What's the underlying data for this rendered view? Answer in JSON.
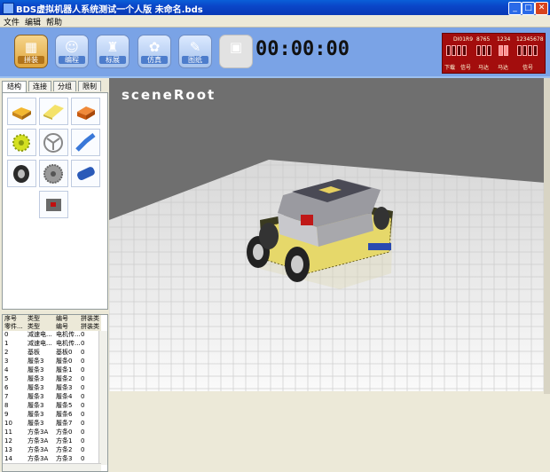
{
  "window": {
    "title": "BDS虚拟机器人系统测试一个人版    未命名.bds"
  },
  "menu": [
    "文件",
    "编辑",
    "帮助"
  ],
  "toolbar": {
    "buttons": [
      {
        "label": "拼装",
        "icon": "assemble-icon",
        "state": "active"
      },
      {
        "label": "编程",
        "icon": "program-icon",
        "state": "normal"
      },
      {
        "label": "标展",
        "icon": "display-icon",
        "state": "normal"
      },
      {
        "label": "仿真",
        "icon": "simulate-icon",
        "state": "normal"
      },
      {
        "label": "图纸",
        "icon": "drawing-icon",
        "state": "normal"
      },
      {
        "label": "",
        "icon": "robot-icon",
        "state": "disabled"
      }
    ],
    "timer": "00:00:00"
  },
  "control_panel": {
    "top_labels": [
      "DI01R9",
      "8765",
      "1234",
      "12345678"
    ],
    "bottom_labels": [
      "下载",
      "信号",
      "马达",
      "信号"
    ]
  },
  "tabs": [
    "结构",
    "连接",
    "分组",
    "限制"
  ],
  "parts": [
    {
      "name": "part-brick",
      "color": "#e8a01a"
    },
    {
      "name": "part-plate",
      "color": "#f0d84a"
    },
    {
      "name": "part-wedge",
      "color": "#e86a1a"
    },
    {
      "name": "part-gear",
      "color": "#c8d820"
    },
    {
      "name": "part-wheel-hub",
      "color": "#a0a0a0"
    },
    {
      "name": "part-beam",
      "color": "#3a78d8"
    },
    {
      "name": "part-tire",
      "color": "#2a2a2a"
    },
    {
      "name": "part-big-gear",
      "color": "#909090"
    },
    {
      "name": "part-worm",
      "color": "#2a5ab8"
    },
    {
      "name": "part-motor",
      "color": "#707070"
    }
  ],
  "table": {
    "header1": [
      "序号",
      "类型",
      "编号",
      "拼装类"
    ],
    "header2": [
      "零件...",
      "类型",
      "编号",
      "拼装类"
    ],
    "rows": [
      [
        "0",
        "减速电...",
        "电机传...",
        "0"
      ],
      [
        "1",
        "减速电...",
        "电机传...",
        "0"
      ],
      [
        "2",
        "基板",
        "基板0",
        "0"
      ],
      [
        "3",
        "履条3",
        "履条0",
        "0"
      ],
      [
        "4",
        "履条3",
        "履条1",
        "0"
      ],
      [
        "5",
        "履条3",
        "履条2",
        "0"
      ],
      [
        "6",
        "履条3",
        "履条3",
        "0"
      ],
      [
        "7",
        "履条3",
        "履条4",
        "0"
      ],
      [
        "8",
        "履条3",
        "履条5",
        "0"
      ],
      [
        "9",
        "履条3",
        "履条6",
        "0"
      ],
      [
        "10",
        "履条3",
        "履条7",
        "0"
      ],
      [
        "11",
        "方条3A",
        "方条0",
        "0"
      ],
      [
        "12",
        "方条3A",
        "方条1",
        "0"
      ],
      [
        "13",
        "方条3A",
        "方条2",
        "0"
      ],
      [
        "14",
        "方条3A",
        "方条3",
        "0"
      ]
    ]
  },
  "viewport": {
    "label": "sceneRoot"
  }
}
